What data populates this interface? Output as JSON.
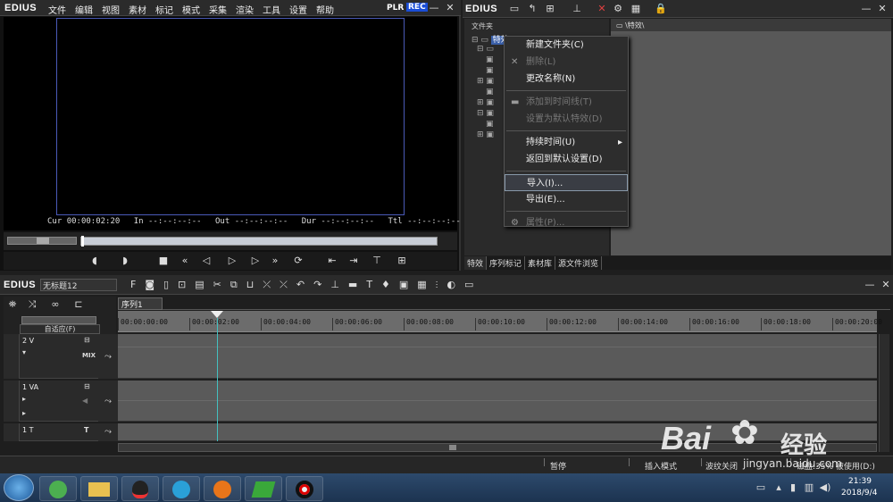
{
  "player": {
    "logo": "EDIUS",
    "menu": [
      "文件",
      "编辑",
      "视图",
      "素材",
      "标记",
      "模式",
      "采集",
      "渲染",
      "工具",
      "设置",
      "帮助"
    ],
    "plr": "PLR",
    "rec": "REC",
    "timecodes": {
      "cur_label": "Cur",
      "cur": "00:00:02:20",
      "in_label": "In",
      "in": "--:--:--:--",
      "out_label": "Out",
      "out": "--:--:--:--",
      "dur_label": "Dur",
      "dur": "--:--:--:--",
      "ttl_label": "Ttl",
      "ttl": "--:--:--:--"
    }
  },
  "bin": {
    "logo": "EDIUS",
    "folder_header": "文件夹",
    "tree_root": "特效",
    "path": "\\特效\\",
    "tabs": [
      "特效",
      "序列标记",
      "素材库",
      "源文件浏览"
    ]
  },
  "context_menu": {
    "items": [
      {
        "label": "新建文件夹(C)",
        "disabled": false
      },
      {
        "label": "删除(L)",
        "disabled": true
      },
      {
        "label": "更改名称(N)",
        "disabled": false
      },
      {
        "sep": true
      },
      {
        "label": "添加到时间线(T)",
        "disabled": true
      },
      {
        "label": "设置为默认特效(D)",
        "disabled": true
      },
      {
        "sep": true
      },
      {
        "label": "持续时间(U)",
        "disabled": false,
        "submenu": true
      },
      {
        "label": "返回到默认设置(D)",
        "disabled": false
      },
      {
        "sep": true
      },
      {
        "label": "导入(I)...",
        "disabled": false,
        "highlight": true
      },
      {
        "label": "导出(E)...",
        "disabled": false
      },
      {
        "sep": true
      },
      {
        "label": "属性(P)...",
        "disabled": true
      }
    ]
  },
  "timeline": {
    "logo": "EDIUS",
    "project_name": "无标题12",
    "sequence_tab": "序列1",
    "mode_label": "自适应(F)",
    "ruler": [
      "00:00:00:00",
      "00:00:02:00",
      "00:00:04:00",
      "00:00:06:00",
      "00:00:08:00",
      "00:00:10:00",
      "00:00:12:00",
      "00:00:14:00",
      "00:00:16:00",
      "00:00:18:00",
      "00:00:20:00"
    ],
    "tracks": [
      {
        "name": "2 V",
        "mix": "MIX"
      },
      {
        "name": "1 VA",
        "mix": ""
      },
      {
        "name": "1 T",
        "mix": "T"
      }
    ]
  },
  "status": {
    "pause": "暂停",
    "insert_mode": "插入模式",
    "ripple_off": "波纹关闭",
    "disk": "磁盘:35% 被使用(D:)"
  },
  "watermark": {
    "brand": "Bai",
    "brand_cn": "经验",
    "url": "jingyan.baidu.com"
  },
  "taskbar": {
    "time": "21:39",
    "date": "2018/9/4"
  },
  "colors": {
    "rec_blue": "#1a4dd6",
    "monitor_border": "#4a5ab8",
    "playhead": "#44c0c0",
    "taskbar": "#1c3350"
  }
}
